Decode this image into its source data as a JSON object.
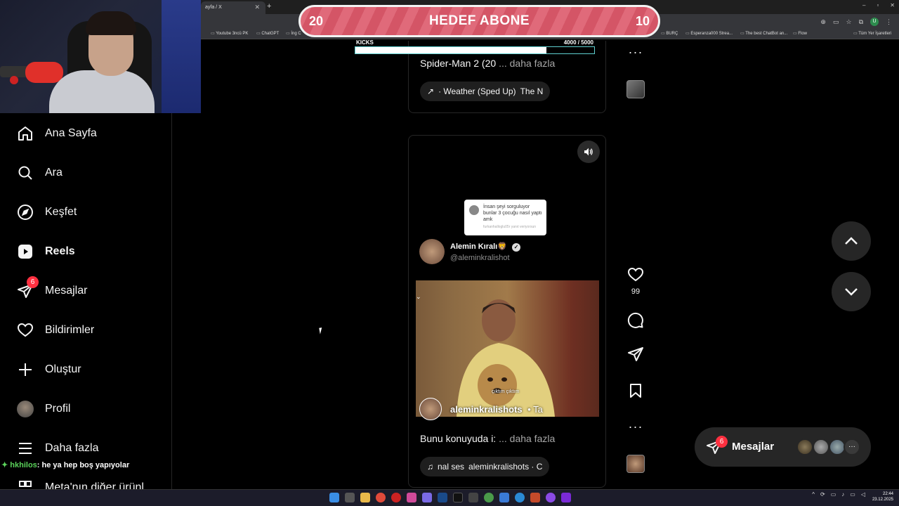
{
  "browser": {
    "tab_title": "ayfa / X",
    "new_tab_icon": "plus-icon",
    "window_controls": [
      "–",
      "▫",
      "✕"
    ],
    "profile_initial": "U",
    "bookmarks": [
      "Youtube 3ncü PK",
      "ChatGPT",
      "İng C",
      "BURÇ",
      "Esperanza000 Strea...",
      "The best ChatBot an...",
      "Flow",
      "Tüm Yer İşaretleri"
    ]
  },
  "stream_goal": {
    "left_count": "20",
    "title": "HEDEF ABONE",
    "right_count": "10"
  },
  "kicks": {
    "label": "KICKS",
    "value_text": "4000  / 5000",
    "progress": 0.8
  },
  "sidebar": {
    "items": [
      {
        "label": "Ana Sayfa",
        "icon": "home-icon"
      },
      {
        "label": "Ara",
        "icon": "search-icon"
      },
      {
        "label": "Keşfet",
        "icon": "compass-icon"
      },
      {
        "label": "Reels",
        "icon": "reels-icon"
      },
      {
        "label": "Mesajlar",
        "icon": "messenger-icon",
        "badge": "6"
      },
      {
        "label": "Bildirimler",
        "icon": "heart-icon"
      },
      {
        "label": "Oluştur",
        "icon": "plus-icon"
      },
      {
        "label": "Profil",
        "icon": "avatar"
      },
      {
        "label": "Daha fazla",
        "icon": "menu-icon"
      },
      {
        "label": "Meta'nın diğer ürünl",
        "icon": "meta-icon"
      }
    ]
  },
  "chat": {
    "user": "hkhilos",
    "message": ": he ya hep boş yapıyolar"
  },
  "post1": {
    "caption": "Spider-Man 2 (20",
    "more": "... daha fazla",
    "audio_prefix": "· Weather (Sped Up)",
    "audio_artist": "The N"
  },
  "post2": {
    "bubble_text": "İnsan şeyi sorguluyor bunlar 3 çocuğu nasıl yaptı amk",
    "bubble_sub": "furkanhalloglu05r yanıt veriyorsun",
    "author_name": "Alemin Kıralı🦁",
    "author_handle": "@aleminkralishot",
    "video_subtitle": "çıktım çıktım",
    "video_username": "aleminkralishots",
    "video_user_suffix": "•   Ta",
    "caption": "Bunu konuyuda i:",
    "more": "... daha fazla",
    "audio_prefix": "nal ses",
    "audio_artist": "aleminkralishots · C"
  },
  "actions": {
    "likes": "99"
  },
  "messages_pill": {
    "label": "Mesajlar",
    "badge": "6",
    "more": "···"
  },
  "taskbar": {
    "time": "22:44",
    "date": "23.12.2025"
  }
}
